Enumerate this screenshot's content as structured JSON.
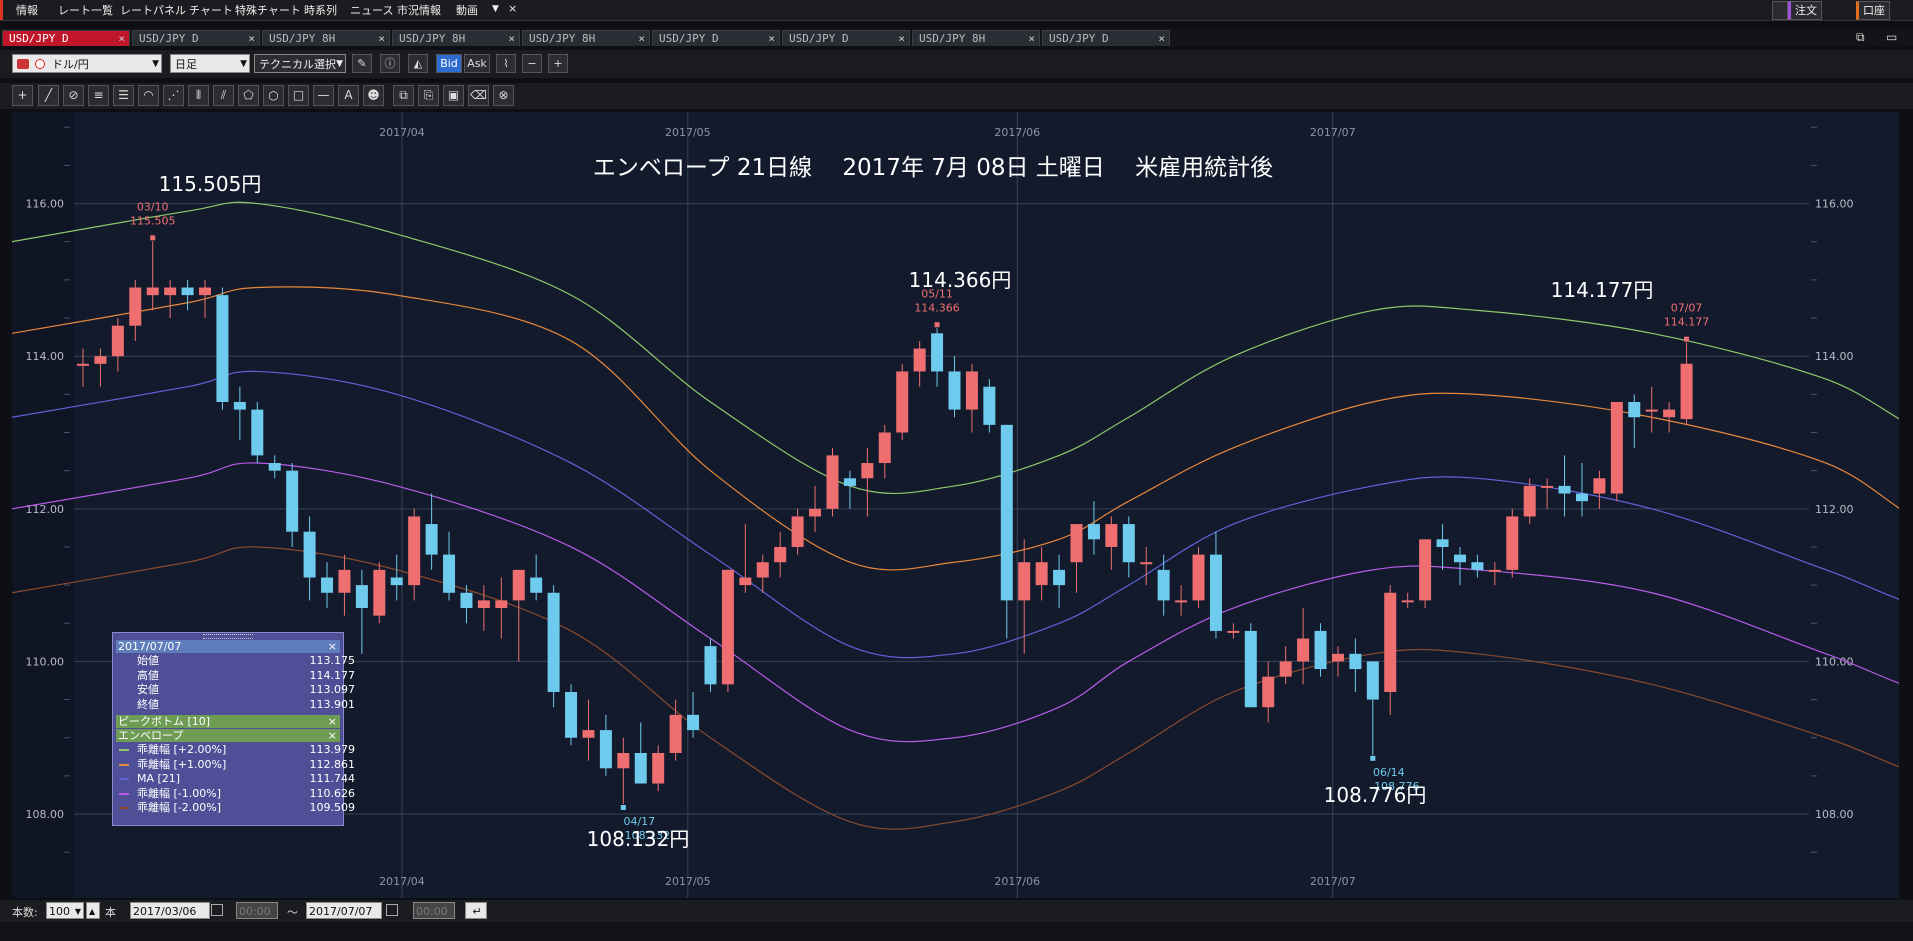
{
  "menu": {
    "items": [
      "情報",
      "レート一覧",
      "レートパネル",
      "チャート",
      "特殊チャート",
      "時系列",
      "ニュース",
      "市況情報",
      "動画"
    ],
    "more": "▼",
    "close": "×",
    "order_button": "注文",
    "account_button": "口座"
  },
  "tabs": [
    {
      "label": "USD/JPY D",
      "active": true
    },
    {
      "label": "USD/JPY D",
      "active": false
    },
    {
      "label": "USD/JPY 8H",
      "active": false
    },
    {
      "label": "USD/JPY 8H",
      "active": false
    },
    {
      "label": "USD/JPY 8H",
      "active": false
    },
    {
      "label": "USD/JPY D",
      "active": false
    },
    {
      "label": "USD/JPY D",
      "active": false
    },
    {
      "label": "USD/JPY 8H",
      "active": false
    },
    {
      "label": "USD/JPY D",
      "active": false
    }
  ],
  "toolbar": {
    "pair": "ドル/円",
    "period": "日足",
    "technical": "テクニカル選択",
    "bid": "Bid",
    "ask": "Ask"
  },
  "chart": {
    "title": "エンベロープ 21日線　 2017年 7月 08日 土曜日　 米雇用統計後",
    "x_labels": [
      "2017/04",
      "2017/05",
      "2017/06",
      "2017/07"
    ],
    "y_labels": [
      "116.00",
      "114.00",
      "112.00",
      "110.00",
      "108.00"
    ],
    "big_labels": [
      "115.505円",
      "114.366円",
      "114.177円",
      "108.132円",
      "108.776円"
    ],
    "peak_labels": [
      {
        "date": "03/10",
        "value": "115.505",
        "kind": "high"
      },
      {
        "date": "05/11",
        "value": "114.366",
        "kind": "high"
      },
      {
        "date": "07/07",
        "value": "114.177",
        "kind": "high"
      },
      {
        "date": "04/17",
        "value": "108.132",
        "kind": "low"
      },
      {
        "date": "06/14",
        "value": "108.776",
        "kind": "low"
      }
    ],
    "colors": {
      "up": "#ef6f71",
      "down": "#6fcbee",
      "env_p2": "#8fc96b",
      "env_p1": "#e8883a",
      "ma": "#5e63d8",
      "env_m1": "#b85ce8",
      "env_m2": "#8a4a2c",
      "bg": "#121a2c"
    }
  },
  "chart_data": {
    "type": "candlestick",
    "ylim": [
      106.9,
      117.2
    ],
    "candles": [
      [
        113.9,
        114.1,
        113.6,
        113.9
      ],
      [
        113.9,
        114.1,
        113.6,
        114.0
      ],
      [
        114.0,
        114.5,
        113.8,
        114.4
      ],
      [
        114.4,
        115.0,
        114.2,
        114.9
      ],
      [
        114.8,
        115.505,
        114.6,
        114.9
      ],
      [
        114.8,
        115.0,
        114.5,
        114.9
      ],
      [
        114.9,
        115.0,
        114.6,
        114.8
      ],
      [
        114.8,
        115.0,
        114.5,
        114.9
      ],
      [
        114.8,
        114.9,
        113.3,
        113.4
      ],
      [
        113.4,
        113.6,
        112.9,
        113.3
      ],
      [
        113.3,
        113.4,
        112.6,
        112.7
      ],
      [
        112.6,
        112.7,
        112.4,
        112.5
      ],
      [
        112.5,
        112.6,
        111.5,
        111.7
      ],
      [
        111.7,
        111.9,
        110.8,
        111.1
      ],
      [
        111.1,
        111.3,
        110.7,
        110.9
      ],
      [
        110.9,
        111.4,
        110.6,
        111.2
      ],
      [
        111.0,
        111.2,
        110.1,
        110.7
      ],
      [
        110.6,
        111.3,
        110.5,
        111.2
      ],
      [
        111.1,
        111.4,
        110.8,
        111.0
      ],
      [
        111.0,
        112.0,
        110.8,
        111.9
      ],
      [
        111.8,
        112.2,
        111.2,
        111.4
      ],
      [
        111.4,
        111.7,
        110.8,
        110.9
      ],
      [
        110.9,
        111.0,
        110.5,
        110.7
      ],
      [
        110.7,
        111.0,
        110.4,
        110.8
      ],
      [
        110.7,
        111.1,
        110.3,
        110.8
      ],
      [
        110.8,
        111.2,
        110.0,
        111.2
      ],
      [
        111.1,
        111.4,
        110.8,
        110.9
      ],
      [
        110.9,
        111.0,
        109.4,
        109.6
      ],
      [
        109.6,
        109.7,
        108.9,
        109.0
      ],
      [
        109.0,
        109.5,
        108.7,
        109.1
      ],
      [
        109.1,
        109.3,
        108.5,
        108.6
      ],
      [
        108.6,
        109.0,
        108.132,
        108.8
      ],
      [
        108.8,
        109.2,
        108.4,
        108.4
      ],
      [
        108.4,
        108.9,
        108.3,
        108.8
      ],
      [
        108.8,
        109.5,
        108.7,
        109.3
      ],
      [
        109.3,
        109.6,
        109.0,
        109.1
      ],
      [
        110.2,
        110.3,
        109.6,
        109.7
      ],
      [
        109.7,
        111.2,
        109.6,
        111.2
      ],
      [
        111.0,
        111.8,
        110.9,
        111.1
      ],
      [
        111.1,
        111.4,
        110.9,
        111.3
      ],
      [
        111.3,
        111.7,
        111.1,
        111.5
      ],
      [
        111.5,
        112.0,
        111.4,
        111.9
      ],
      [
        111.9,
        112.3,
        111.7,
        112.0
      ],
      [
        112.0,
        112.8,
        111.9,
        112.7
      ],
      [
        112.4,
        112.5,
        112.0,
        112.3
      ],
      [
        112.4,
        112.8,
        111.9,
        112.6
      ],
      [
        112.6,
        113.1,
        112.4,
        113.0
      ],
      [
        113.0,
        113.9,
        112.9,
        113.8
      ],
      [
        113.8,
        114.2,
        113.6,
        114.1
      ],
      [
        114.3,
        114.366,
        113.6,
        113.8
      ],
      [
        113.8,
        114.0,
        113.2,
        113.3
      ],
      [
        113.3,
        113.9,
        113.0,
        113.8
      ],
      [
        113.6,
        113.7,
        113.0,
        113.1
      ],
      [
        113.1,
        113.1,
        110.3,
        110.8
      ],
      [
        110.8,
        111.6,
        110.1,
        111.3
      ],
      [
        111.0,
        111.5,
        110.8,
        111.3
      ],
      [
        111.2,
        111.4,
        110.7,
        111.0
      ],
      [
        111.3,
        111.8,
        110.9,
        111.8
      ],
      [
        111.8,
        112.1,
        111.4,
        111.6
      ],
      [
        111.5,
        111.9,
        111.2,
        111.8
      ],
      [
        111.8,
        111.9,
        111.1,
        111.3
      ],
      [
        111.3,
        111.5,
        111.0,
        111.3
      ],
      [
        111.2,
        111.4,
        110.6,
        110.8
      ],
      [
        110.8,
        111.0,
        110.6,
        110.8
      ],
      [
        110.8,
        111.5,
        110.7,
        111.4
      ],
      [
        111.4,
        111.7,
        110.3,
        110.4
      ],
      [
        110.4,
        110.5,
        110.3,
        110.4
      ],
      [
        110.4,
        110.5,
        109.4,
        109.4
      ],
      [
        109.4,
        110.0,
        109.2,
        109.8
      ],
      [
        109.8,
        110.2,
        109.7,
        110.0
      ],
      [
        110.0,
        110.7,
        109.7,
        110.3
      ],
      [
        110.4,
        110.5,
        109.8,
        109.9
      ],
      [
        110.0,
        110.2,
        109.8,
        110.1
      ],
      [
        110.1,
        110.3,
        109.6,
        109.9
      ],
      [
        110.0,
        110.0,
        108.776,
        109.5
      ],
      [
        109.6,
        111.0,
        109.3,
        110.9
      ],
      [
        110.8,
        110.9,
        110.7,
        110.8
      ],
      [
        110.8,
        111.6,
        110.7,
        111.6
      ],
      [
        111.6,
        111.8,
        111.2,
        111.5
      ],
      [
        111.4,
        111.5,
        111.0,
        111.3
      ],
      [
        111.3,
        111.4,
        111.1,
        111.2
      ],
      [
        111.2,
        111.3,
        111.0,
        111.2
      ],
      [
        111.2,
        112.0,
        111.1,
        111.9
      ],
      [
        111.9,
        112.4,
        111.8,
        112.3
      ],
      [
        112.3,
        112.4,
        112.0,
        112.3
      ],
      [
        112.3,
        112.7,
        111.9,
        112.2
      ],
      [
        112.2,
        112.6,
        111.9,
        112.1
      ],
      [
        112.2,
        112.5,
        112.0,
        112.4
      ],
      [
        112.2,
        113.4,
        112.1,
        113.4
      ],
      [
        113.4,
        113.5,
        112.8,
        113.2
      ],
      [
        113.3,
        113.6,
        113.0,
        113.3
      ],
      [
        113.2,
        113.4,
        113.0,
        113.3
      ],
      [
        113.175,
        114.177,
        113.097,
        113.901
      ]
    ],
    "envelope": {
      "upper2": [
        [
          0,
          115.5
        ],
        [
          6,
          115.9
        ],
        [
          10,
          116.0
        ],
        [
          18,
          115.6
        ],
        [
          28,
          114.8
        ],
        [
          36,
          113.4
        ],
        [
          44,
          112.3
        ],
        [
          50,
          112.3
        ],
        [
          56,
          112.7
        ],
        [
          60,
          113.2
        ],
        [
          66,
          114.0
        ],
        [
          74,
          114.6
        ],
        [
          80,
          114.6
        ],
        [
          90,
          114.3
        ],
        [
          100,
          113.7
        ],
        [
          106,
          113.0
        ],
        [
          112,
          113.0
        ],
        [
          118,
          112.9
        ],
        [
          124,
          113.2
        ],
        [
          130,
          113.5
        ],
        [
          135,
          114.0
        ]
      ],
      "upper1": [
        [
          0,
          114.3
        ],
        [
          6,
          114.7
        ],
        [
          10,
          114.9
        ],
        [
          18,
          114.8
        ],
        [
          28,
          114.2
        ],
        [
          36,
          112.5
        ],
        [
          44,
          111.3
        ],
        [
          50,
          111.3
        ],
        [
          56,
          111.6
        ],
        [
          60,
          112.1
        ],
        [
          66,
          112.8
        ],
        [
          74,
          113.4
        ],
        [
          80,
          113.5
        ],
        [
          90,
          113.2
        ],
        [
          100,
          112.6
        ],
        [
          106,
          111.8
        ],
        [
          112,
          111.8
        ],
        [
          118,
          111.8
        ],
        [
          124,
          112.0
        ],
        [
          130,
          112.4
        ],
        [
          135,
          112.9
        ]
      ],
      "ma": [
        [
          0,
          113.2
        ],
        [
          6,
          113.6
        ],
        [
          10,
          113.8
        ],
        [
          18,
          113.5
        ],
        [
          28,
          112.6
        ],
        [
          36,
          111.4
        ],
        [
          44,
          110.2
        ],
        [
          50,
          110.1
        ],
        [
          56,
          110.5
        ],
        [
          60,
          111.0
        ],
        [
          66,
          111.8
        ],
        [
          74,
          112.3
        ],
        [
          80,
          112.4
        ],
        [
          90,
          112.0
        ],
        [
          100,
          111.2
        ],
        [
          106,
          110.7
        ],
        [
          112,
          110.7
        ],
        [
          118,
          110.8
        ],
        [
          124,
          111.0
        ],
        [
          130,
          111.3
        ],
        [
          135,
          111.7
        ]
      ],
      "lower1": [
        [
          0,
          112.0
        ],
        [
          6,
          112.4
        ],
        [
          10,
          112.6
        ],
        [
          18,
          112.3
        ],
        [
          28,
          111.5
        ],
        [
          36,
          110.3
        ],
        [
          44,
          109.1
        ],
        [
          50,
          109.0
        ],
        [
          56,
          109.4
        ],
        [
          60,
          110.0
        ],
        [
          66,
          110.7
        ],
        [
          74,
          111.2
        ],
        [
          80,
          111.2
        ],
        [
          90,
          110.9
        ],
        [
          100,
          110.1
        ],
        [
          106,
          109.6
        ],
        [
          112,
          109.6
        ],
        [
          118,
          109.6
        ],
        [
          124,
          109.8
        ],
        [
          130,
          110.1
        ],
        [
          135,
          110.6
        ]
      ],
      "lower2": [
        [
          0,
          110.9
        ],
        [
          6,
          111.3
        ],
        [
          10,
          111.5
        ],
        [
          18,
          111.2
        ],
        [
          28,
          110.4
        ],
        [
          36,
          109.0
        ],
        [
          44,
          107.9
        ],
        [
          50,
          107.9
        ],
        [
          56,
          108.3
        ],
        [
          60,
          108.8
        ],
        [
          66,
          109.6
        ],
        [
          74,
          110.1
        ],
        [
          80,
          110.1
        ],
        [
          90,
          109.7
        ],
        [
          100,
          109.0
        ],
        [
          106,
          108.5
        ],
        [
          112,
          108.5
        ],
        [
          118,
          108.5
        ],
        [
          124,
          108.7
        ],
        [
          130,
          109.0
        ],
        [
          135,
          109.5
        ]
      ]
    }
  },
  "info_panel": {
    "date": "2017/07/07",
    "ohlc": [
      {
        "label": "始値",
        "value": "113.175"
      },
      {
        "label": "高値",
        "value": "114.177"
      },
      {
        "label": "安値",
        "value": "113.097"
      },
      {
        "label": "終値",
        "value": "113.901"
      }
    ],
    "peak_bottom": "ピークボトム [10]",
    "envelope_title": "エンベロープ",
    "envelope_rows": [
      {
        "label": "乖離幅 [+2.00%]",
        "value": "113.979",
        "color": "#8fc96b"
      },
      {
        "label": "乖離幅 [+1.00%]",
        "value": "112.861",
        "color": "#e8883a"
      },
      {
        "label": "MA [21]",
        "value": "111.744",
        "color": "#5e63d8"
      },
      {
        "label": "乖離幅 [-1.00%]",
        "value": "110.626",
        "color": "#b85ce8"
      },
      {
        "label": "乖離幅 [-2.00%]",
        "value": "109.509",
        "color": "#8a4a2c"
      }
    ],
    "close": "×"
  },
  "status": {
    "count_label": "本数:",
    "count_value": "100",
    "count_unit": "本",
    "from_date": "2017/03/06",
    "from_time": "00:00",
    "tilde": "～",
    "to_date": "2017/07/07",
    "to_time": "00:00"
  }
}
